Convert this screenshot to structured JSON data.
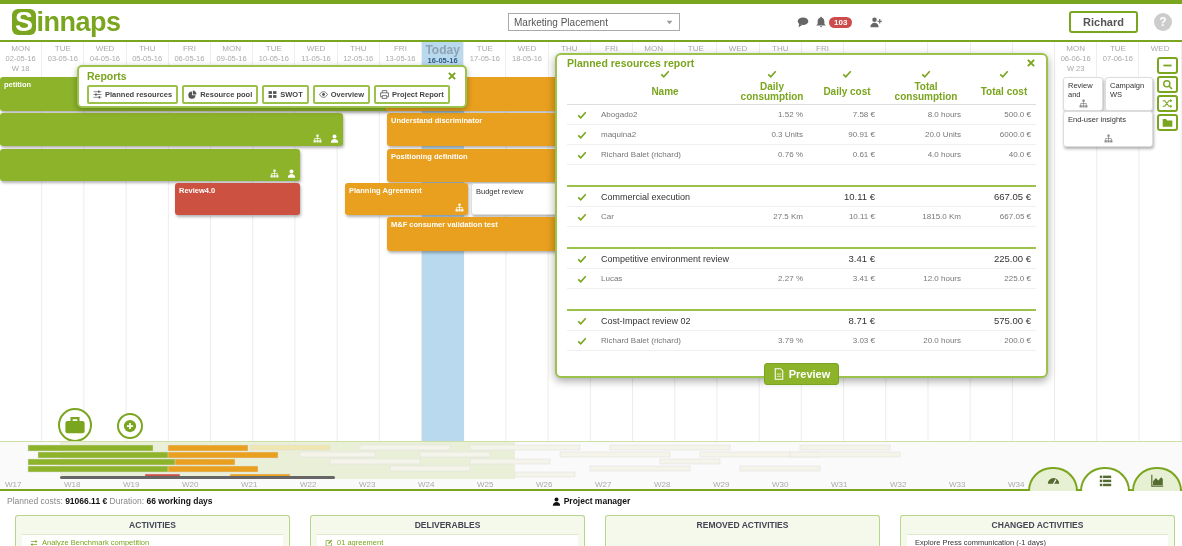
{
  "header": {
    "logo": "Sinnaps",
    "project_select": "Marketing Placement",
    "notifications": "103",
    "user": "Richard",
    "help": "?"
  },
  "timeline": {
    "days": [
      {
        "day": "MON",
        "date": "02-05-16",
        "week": "W 18",
        "today": false
      },
      {
        "day": "TUE",
        "date": "03-05-16",
        "today": false
      },
      {
        "day": "WED",
        "date": "04-05-16",
        "today": false
      },
      {
        "day": "THU",
        "date": "05-05-16",
        "today": false
      },
      {
        "day": "FRI",
        "date": "06-05-16",
        "today": false
      },
      {
        "day": "MON",
        "date": "09-05-16",
        "today": false
      },
      {
        "day": "TUE",
        "date": "10-05-16",
        "today": false
      },
      {
        "day": "WED",
        "date": "11-05-16",
        "today": false
      },
      {
        "day": "THU",
        "date": "12-05-16",
        "today": false
      },
      {
        "day": "FRI",
        "date": "13-05-16",
        "today": false
      },
      {
        "day": "Today",
        "date": "16-05-16",
        "today": true
      },
      {
        "day": "TUE",
        "date": "17-05-16",
        "today": false
      },
      {
        "day": "WED",
        "date": "18-05-16",
        "today": false
      },
      {
        "day": "THU",
        "today": false
      },
      {
        "day": "FRI",
        "today": false
      },
      {
        "day": "MON",
        "today": false
      },
      {
        "day": "TUE",
        "today": false
      },
      {
        "day": "WED",
        "today": false
      },
      {
        "day": "THU",
        "today": false
      },
      {
        "day": "FRI",
        "today": false
      },
      {
        "today": false
      },
      {
        "today": false
      },
      {
        "today": false
      },
      {
        "today": false
      },
      {
        "today": false
      },
      {
        "day": "MON",
        "date": "06-06-16",
        "week": "W 23",
        "today": false
      },
      {
        "day": "TUE",
        "date": "07-06-16",
        "today": false
      },
      {
        "day": "WED",
        "today": false
      }
    ]
  },
  "gantt": {
    "bars": [
      {
        "label": "petition",
        "color": "#8db32a"
      },
      {
        "color": "#e8a01e"
      },
      {
        "color": "#8db32a"
      },
      {
        "label": "Understand discriminator",
        "color": "#e8a01e"
      },
      {
        "color": "#8db32a"
      },
      {
        "label": "Positioning definition",
        "color": "#e8a01e"
      },
      {
        "label": "Review4.0",
        "color": "#cd5140"
      },
      {
        "label": "Planning Agreement",
        "color": "#e8a01e"
      },
      {
        "label": "Budget review",
        "color": "#ffffff"
      },
      {
        "label": "M&F consumer validation test",
        "color": "#e8a01e"
      },
      {
        "label": "Review and",
        "color": "#ffffff"
      },
      {
        "label": "Campaign WS",
        "color": "#ffffff"
      },
      {
        "label": "End-user insights",
        "color": "#ffffff"
      }
    ]
  },
  "reports": {
    "title": "Reports",
    "buttons": [
      "Planned resources",
      "Resource pool",
      "SWOT",
      "Overview",
      "Project Report"
    ]
  },
  "resources_report": {
    "title": "Planned resources report",
    "columns": [
      {
        "label": "Name",
        "checked": true
      },
      {
        "label": "Daily consumption",
        "checked": true
      },
      {
        "label": "Daily cost",
        "checked": true
      },
      {
        "label": "Total consumption",
        "checked": true
      },
      {
        "label": "Total cost",
        "checked": true
      }
    ],
    "rows": [
      {
        "kind": "item",
        "checked": true,
        "name": "Abogado2",
        "daily_consumption": "1.52 %",
        "daily_cost": "7.58 €",
        "total_consumption": "8.0 hours",
        "total_cost": "500.0 €"
      },
      {
        "kind": "item",
        "checked": true,
        "name": "maquina2",
        "daily_consumption": "0.3 Units",
        "daily_cost": "90.91 €",
        "total_consumption": "20.0 Units",
        "total_cost": "6000.0 €"
      },
      {
        "kind": "item",
        "checked": true,
        "name": "Richard Balet (richard)",
        "daily_consumption": "0.76 %",
        "daily_cost": "0.61 €",
        "total_consumption": "4.0 hours",
        "total_cost": "40.0 €"
      },
      {
        "kind": "group",
        "checked": true,
        "name": "Commercial execution",
        "daily_cost": "10.11 €",
        "total_cost": "667.05 €"
      },
      {
        "kind": "item",
        "checked": true,
        "name": "Car",
        "daily_consumption": "27.5 Km",
        "daily_cost": "10.11 €",
        "total_consumption": "1815.0 Km",
        "total_cost": "667.05 €"
      },
      {
        "kind": "group",
        "checked": true,
        "name": "Competitive environment review",
        "daily_cost": "3.41 €",
        "total_cost": "225.00 €"
      },
      {
        "kind": "item",
        "checked": true,
        "name": "Lucas",
        "daily_consumption": "2.27 %",
        "daily_cost": "3.41 €",
        "total_consumption": "12.0 hours",
        "total_cost": "225.0 €"
      },
      {
        "kind": "group",
        "checked": true,
        "name": "Cost-Impact review 02",
        "daily_cost": "8.71 €",
        "total_cost": "575.00 €"
      },
      {
        "kind": "item",
        "checked": true,
        "name": "Richard Balet (richard)",
        "daily_consumption": "3.79 %",
        "daily_cost": "3.03 €",
        "total_consumption": "20.0 hours",
        "total_cost": "200.0 €"
      }
    ],
    "preview": "Preview"
  },
  "minimap": {
    "weeks": [
      "W17",
      "W18",
      "W19",
      "W20",
      "W21",
      "W22",
      "W23",
      "W24",
      "W25",
      "W26",
      "W27",
      "W28",
      "W29",
      "W30",
      "W31",
      "W32",
      "W33",
      "W34"
    ],
    "views": [
      {
        "kind": "dashboard",
        "selected": false
      },
      {
        "kind": "list",
        "selected": true
      },
      {
        "kind": "chart",
        "selected": false
      }
    ]
  },
  "status": {
    "summary": "Planned costs: **91066.11 €**  Duration: **66 working days**",
    "project_manager": "Project manager"
  },
  "panels": [
    {
      "title": "ACTIVITIES",
      "items": [
        {
          "kind": "activity",
          "text": "Analyze Benchmark competition"
        }
      ]
    },
    {
      "title": "DELIVERABLES",
      "items": [
        {
          "kind": "deliverable",
          "text": "01 agreement"
        }
      ]
    },
    {
      "title": "REMOVED ACTIVITIES"
    },
    {
      "title": "CHANGED ACTIVITIES",
      "items": [
        {
          "kind": "change",
          "text": "Explore Press communication (-1 days)"
        }
      ]
    }
  ]
}
